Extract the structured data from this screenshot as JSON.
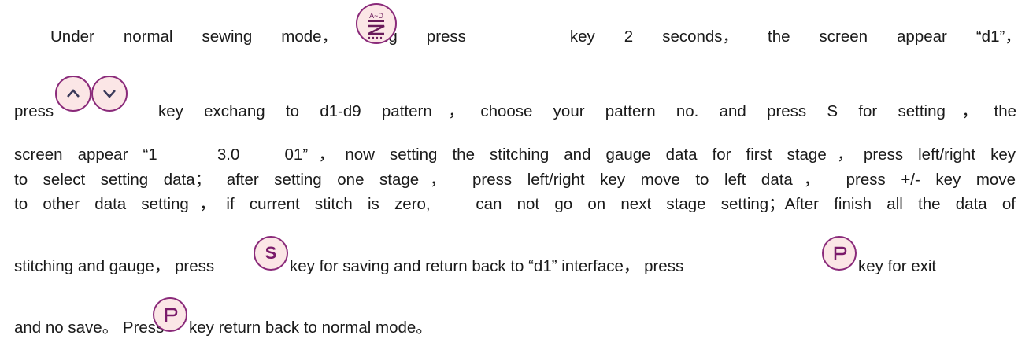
{
  "doc": {
    "p1": [
      "Under",
      "normal",
      "sewing",
      "mode，",
      "long",
      "press",
      "",
      "key",
      "2",
      "seconds，",
      "the",
      "screen",
      "appear",
      "“d1”，"
    ],
    "l2_press": "press",
    "l2_rest": "key exchang to d1-d9 pattern，choose your pattern no. and press S for setting，the",
    "l3": "screen appear “1    3.0   01”，now setting the stitching and gauge data for first stage，press left/right key",
    "l4": "to select setting data； after setting one stage， press left/right key move to left data， press +/- key move",
    "l5": "to other data setting，if current stitch is zero,   can not go on next stage setting；After finish all the data of",
    "l6_a": "stitching and gauge， press",
    "l6_b": "key for saving and return back to “d1” interface， press",
    "l6_c": "key for exit",
    "l7_a": "and no save。 Press",
    "l7_b": "key return back to normal mode。",
    "icons": {
      "pattern_key_label": "A~D",
      "s_key_label": "S",
      "p_key_label": "P"
    },
    "colors": {
      "key_fill": "#fbe6e6",
      "key_border": "#8a2a7a"
    }
  }
}
